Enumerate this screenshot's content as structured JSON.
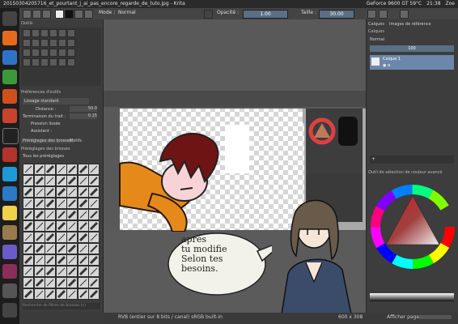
{
  "window": {
    "title": "20150304205716_et_pourtant_j_ai_pas_encore_regarde_de_tuto.jpg - Krita"
  },
  "system_tray": {
    "gpu": "GeForce 9600 GT 59°C",
    "time": "21:38",
    "user": "Zoe"
  },
  "toolbar": {
    "mode_label": "Mode :",
    "mode_value": "Normal",
    "opacity_label": "Opacité :",
    "opacity_value": "1.00",
    "size_label": "Taille :",
    "size_value": "30.00"
  },
  "left_docker": {
    "header": "Outils",
    "tool_options_header": "Préférences d'outils",
    "smoothing_value": "Lissage standard",
    "distance_label": "Distance :",
    "distance_value": "50.0",
    "end_label": "Terminaison du trait :",
    "end_value": "0.15",
    "pressure_label": "Pression lissée",
    "assistant_label": "Assistant :",
    "presets_tabs": [
      "Préréglages des brosses",
      "Motifs"
    ],
    "presets_header": "Préréglages des brosses",
    "presets_filter": "Tous les préréglages",
    "presets_search_placeholder": "Recherche de filtres de brosses (c)"
  },
  "right_docker": {
    "layers_tabs": [
      "Calques",
      "Images de référence"
    ],
    "layers_title": "Calques",
    "blend_mode": "Normal",
    "opacity_value": "100",
    "layer_name": "Calque 1",
    "selector_header": "Outil de sélection de couleur avancé"
  },
  "status": {
    "color_info": "RVB (entier sur 8 bits / canal)  sRGB built-in",
    "dimensions": "600 x 308",
    "page_button": "Afficher page"
  },
  "speech_bubble": {
    "line1": "après",
    "line2": "tu modifie",
    "line3": "Selon tes",
    "line4": "besoins."
  },
  "colors": {
    "accent": "#5a6e86",
    "hair": "#6e1414",
    "scarf": "#e58a1a",
    "shirt": "#3a4c6a"
  }
}
